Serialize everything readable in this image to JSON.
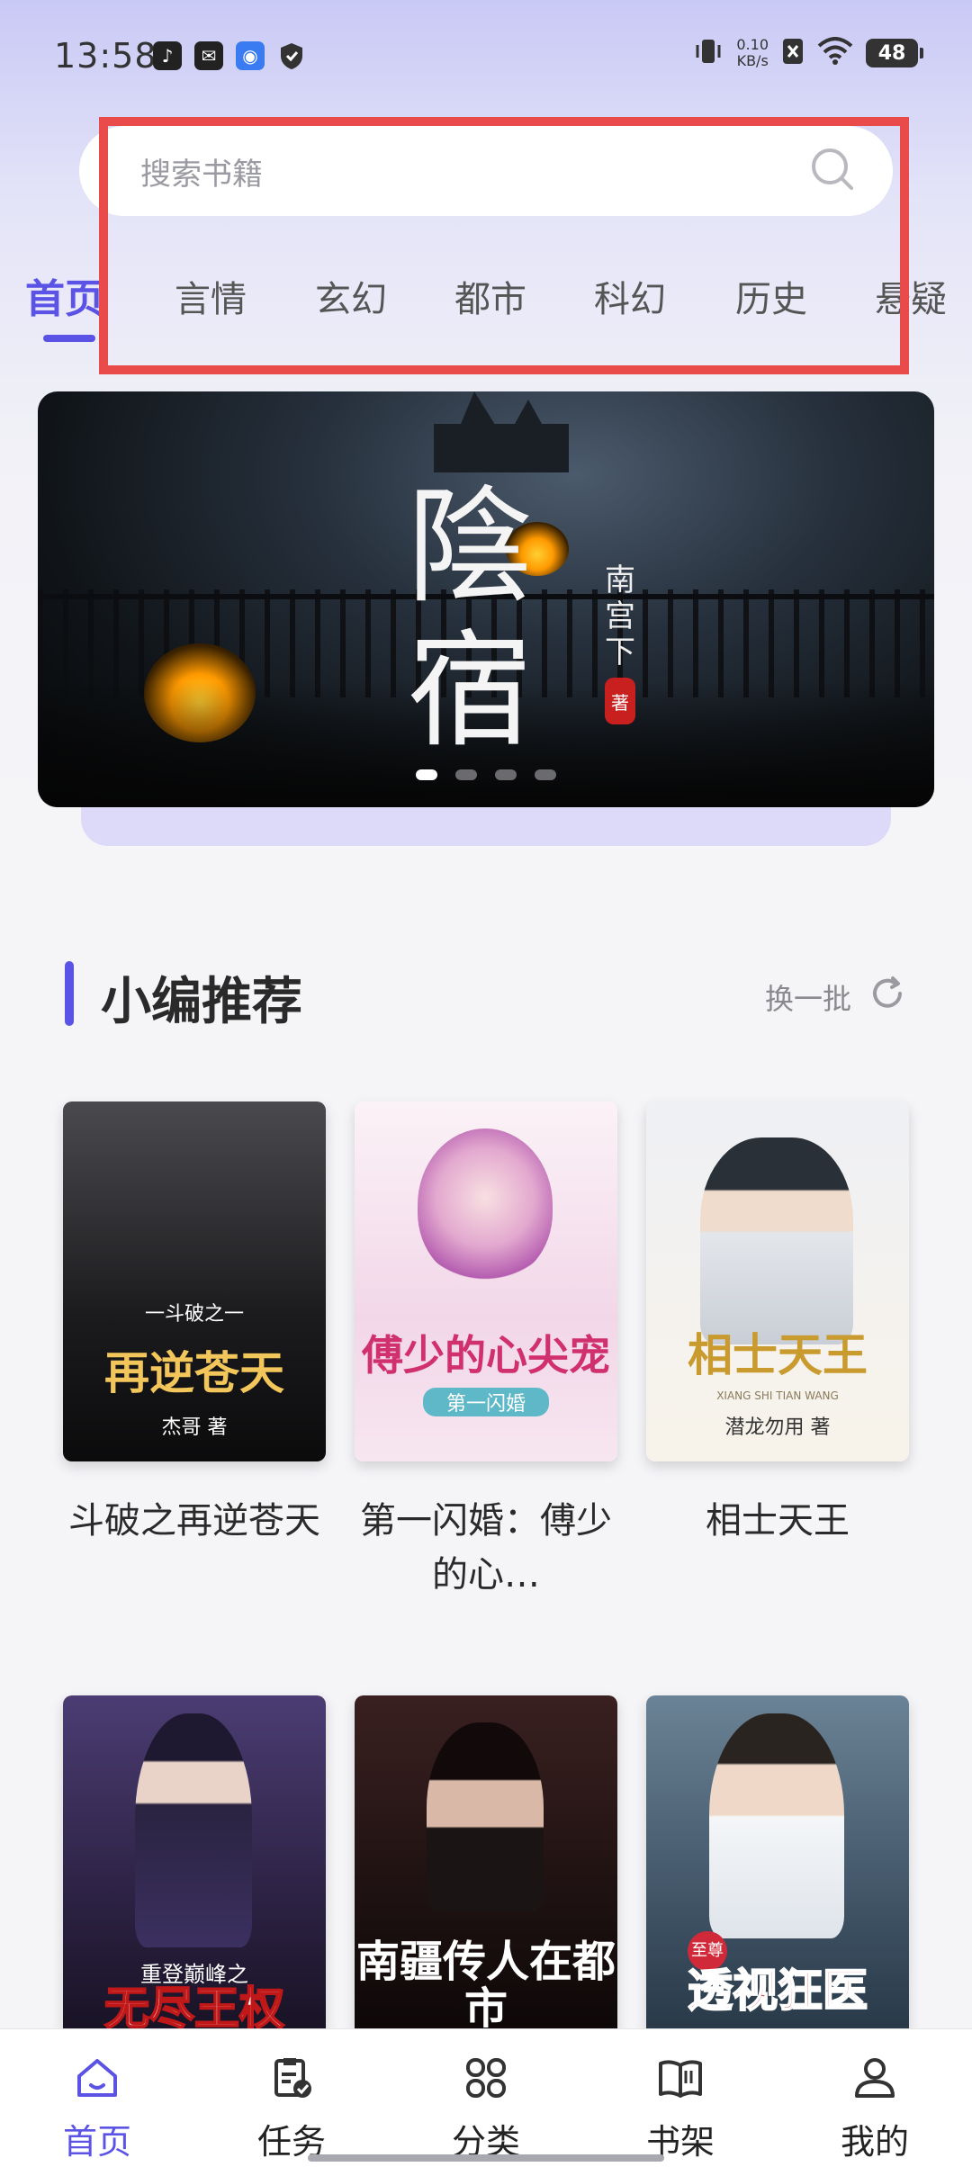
{
  "status_bar": {
    "time": "13:58",
    "net_speed_value": "0.10",
    "net_speed_unit": "KB/s",
    "battery": "48",
    "icons": [
      "tiktok-icon",
      "mail-icon",
      "app-icon",
      "shield-icon",
      "vibrate-icon",
      "sim-off-icon",
      "wifi-icon",
      "battery-icon"
    ]
  },
  "search": {
    "placeholder": "搜索书籍"
  },
  "tabs": [
    "首页",
    "言情",
    "玄幻",
    "都市",
    "科幻",
    "历史",
    "悬疑"
  ],
  "active_tab": "首页",
  "banner": {
    "title_line1": "陰",
    "title_line2": "宿",
    "author": "南宫下",
    "seal": "著",
    "slide_count": 4,
    "active_slide": 1
  },
  "section": {
    "title": "小编推荐",
    "refresh_label": "换一批"
  },
  "books": [
    {
      "title": "斗破之再逆苍天",
      "cover_sub": "一斗破之一",
      "cover_title": "再逆苍天",
      "cover_author": "杰哥 著",
      "colors": {
        "bg_top": "#3a3a3d",
        "bg_bottom": "#0e0e10",
        "title": "#f2d27a"
      }
    },
    {
      "title": "第一闪婚：傅少的心…",
      "cover_sub": "第一闪婚",
      "cover_title": "傅少的心尖宠",
      "cover_author": "",
      "colors": {
        "bg_top": "#f7e9f2",
        "bg_bottom": "#f3d3e6",
        "title": "#d0306e"
      }
    },
    {
      "title": "相士天王",
      "cover_sub": "XIANG SHI TIAN WANG",
      "cover_title": "相士天王",
      "cover_author": "潜龙勿用 著",
      "colors": {
        "bg_top": "#eef0f4",
        "bg_bottom": "#f7f3ea",
        "title": "#c99a2e"
      }
    },
    {
      "title": "",
      "cover_sub": "重登巅峰之",
      "cover_title": "无尽王权",
      "cover_author": "",
      "colors": {
        "bg_top": "#3b2f5a",
        "bg_bottom": "#1b1428",
        "title": "#ffffff"
      }
    },
    {
      "title": "",
      "cover_sub": "",
      "cover_title": "南疆传人在都市",
      "cover_author": "",
      "colors": {
        "bg_top": "#2c1a1a",
        "bg_bottom": "#0d0808",
        "title": "#ffffff"
      }
    },
    {
      "title": "",
      "cover_sub": "至尊",
      "cover_title": "透视狂医",
      "cover_author": "",
      "colors": {
        "bg_top": "#5e7486",
        "bg_bottom": "#243442",
        "title": "#d02a3a"
      }
    }
  ],
  "bottom_nav": [
    {
      "label": "首页",
      "icon": "home-icon",
      "active": true
    },
    {
      "label": "任务",
      "icon": "task-icon",
      "active": false
    },
    {
      "label": "分类",
      "icon": "category-icon",
      "active": false
    },
    {
      "label": "书架",
      "icon": "bookshelf-icon",
      "active": false
    },
    {
      "label": "我的",
      "icon": "profile-icon",
      "active": false
    }
  ],
  "colors": {
    "accent": "#5b52e6",
    "highlight_border": "#e94b4b"
  }
}
